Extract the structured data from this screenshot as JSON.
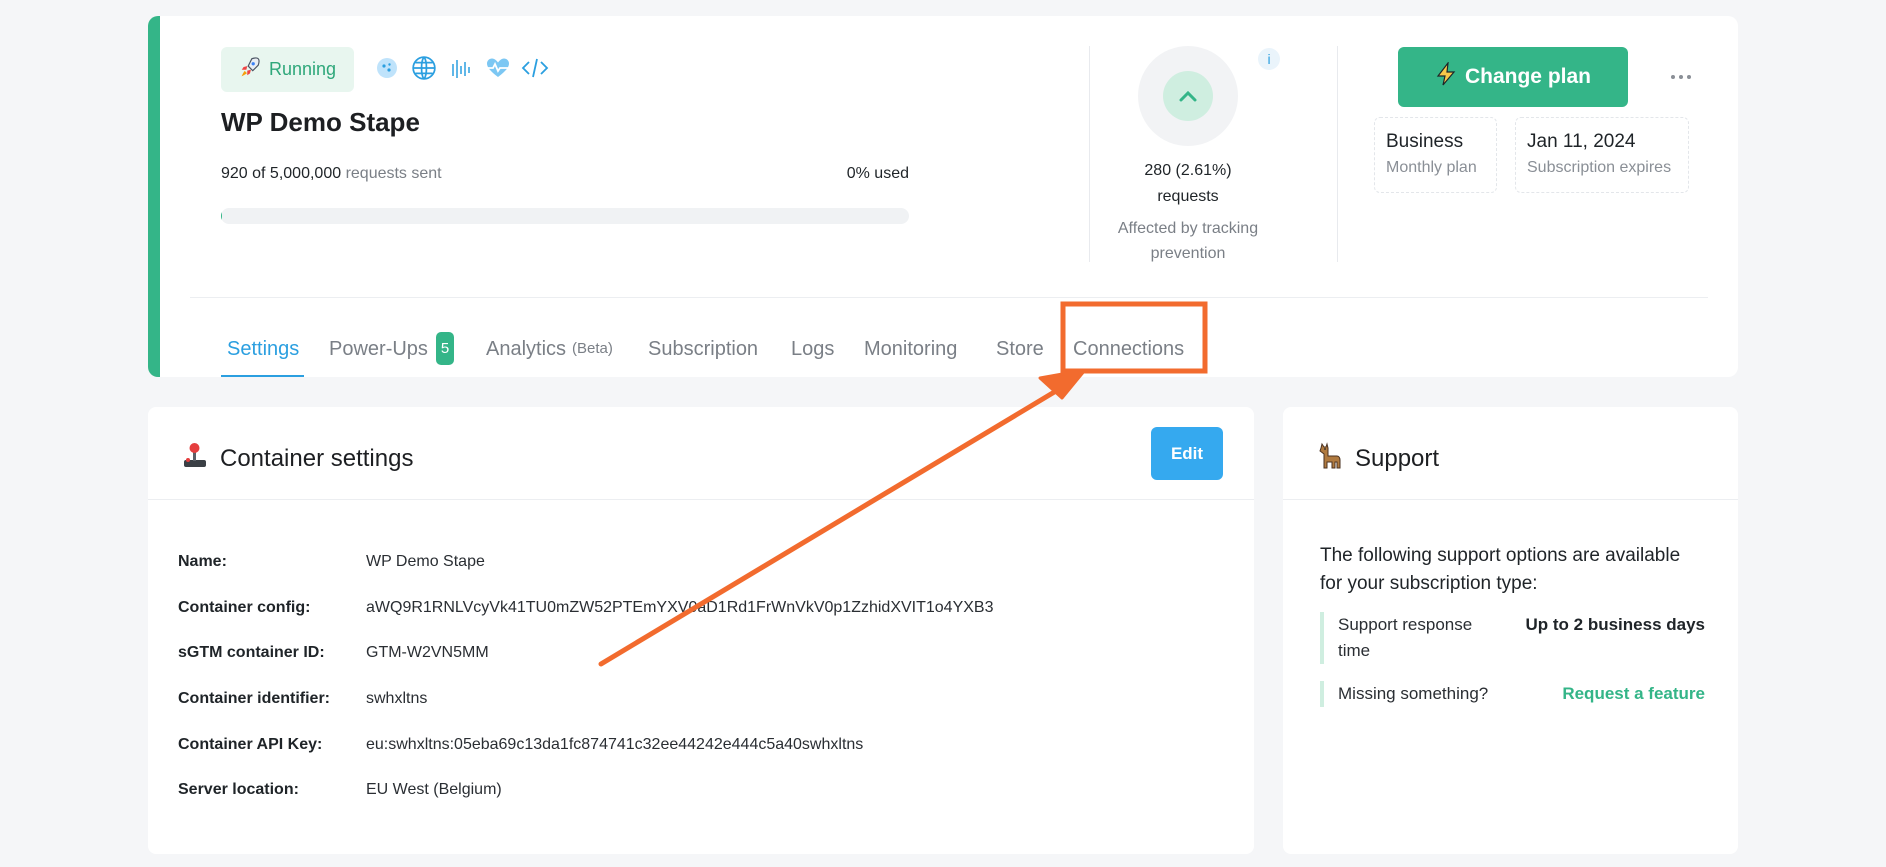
{
  "container": {
    "status": "Running",
    "name": "WP Demo Stape",
    "usage": {
      "sent": "920 of 5,000,000",
      "sent_label": "requests sent",
      "used_label": "0% used",
      "fraction_used": 0.0002
    }
  },
  "tool_icons": [
    "cookie-icon",
    "globe-icon",
    "signal-bars-icon",
    "heartbeat-icon",
    "code-icon"
  ],
  "tracking_prevention": {
    "count": "280 (2.61%)",
    "unit": "requests",
    "description_line1": "Affected by tracking",
    "description_line2": "prevention",
    "info_label": "i"
  },
  "plan": {
    "change_plan_label": "Change plan",
    "plan_name": "Business",
    "plan_period": "Monthly plan",
    "expiry_date": "Jan 11, 2024",
    "expiry_label": "Subscription expires"
  },
  "tabs": {
    "settings": "Settings",
    "power_ups": "Power-Ups",
    "power_ups_count": "5",
    "analytics": "Analytics",
    "analytics_tag": "(Beta)",
    "subscription": "Subscription",
    "logs": "Logs",
    "monitoring": "Monitoring",
    "store": "Store",
    "connections": "Connections"
  },
  "settings_card": {
    "title": "Container settings",
    "edit_label": "Edit",
    "rows": [
      {
        "label": "Name:",
        "value": "WP Demo Stape"
      },
      {
        "label": "Container config:",
        "value": "aWQ9R1RNLVcyVk41TU0mZW52PTEmYXV0aD1Rd1FrWnVkV0p1ZzhidXVIT1o4YXB3"
      },
      {
        "label": "sGTM container ID:",
        "value": "GTM-W2VN5MM"
      },
      {
        "label": "Container identifier:",
        "value": "swhxltns"
      },
      {
        "label": "Container API Key:",
        "value": "eu:swhxltns:05eba69c13da1fc874741c32ee44242e444c5a40swhxltns"
      },
      {
        "label": "Server location:",
        "value": "EU West (Belgium)"
      }
    ]
  },
  "support_card": {
    "title": "Support",
    "intro": "The following support options are available for your subscription type:",
    "response_label": "Support response time",
    "response_value": "Up to 2 business days",
    "missing_label": "Missing something?",
    "missing_link": "Request a feature"
  },
  "colors": {
    "accent_green": "#34b588",
    "accent_blue": "#2b9fe0",
    "annotation_orange": "#f26b2e"
  }
}
